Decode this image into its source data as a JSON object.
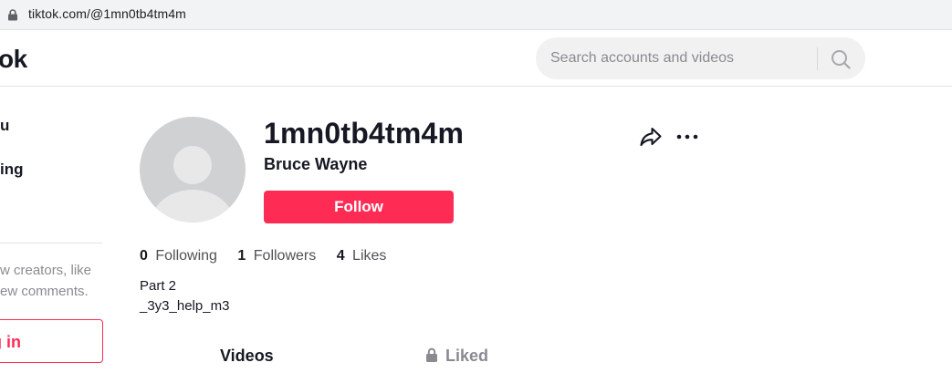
{
  "browser": {
    "url": "tiktok.com/@1mn0tb4tm4m"
  },
  "header": {
    "logo_text": "ok",
    "search_placeholder": "Search accounts and videos"
  },
  "sidebar": {
    "items": [
      {
        "label": "u"
      },
      {
        "label": "ing"
      }
    ],
    "promo_line1": "w creators, like",
    "promo_line2": "ew comments.",
    "login_label": "g in"
  },
  "profile": {
    "username": "1mn0tb4tm4m",
    "nickname": "Bruce Wayne",
    "follow_label": "Follow",
    "stats": {
      "following_count": "0",
      "following_label": "Following",
      "followers_count": "1",
      "followers_label": "Followers",
      "likes_count": "4",
      "likes_label": "Likes"
    },
    "bio_line1": "Part 2",
    "bio_line2": "_3y3_help_m3"
  },
  "tabs": {
    "videos_label": "Videos",
    "liked_label": "Liked"
  },
  "colors": {
    "accent": "#fe2c55",
    "text": "#161823",
    "muted": "#8a8b91",
    "avatar_bg": "#d0d1d3"
  },
  "icons": {
    "lock": "lock-icon",
    "search": "search-icon",
    "share": "share-icon",
    "more": "more-icon",
    "liked_lock": "lock-icon"
  }
}
